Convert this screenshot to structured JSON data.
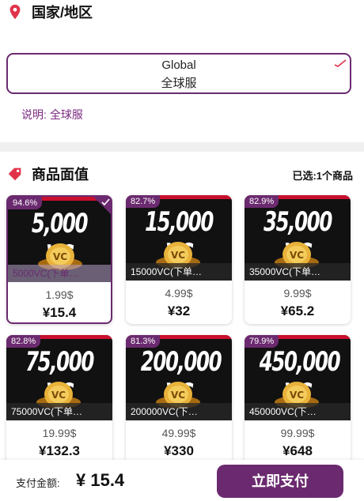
{
  "region": {
    "title": "国家/地区",
    "option_line1": "Global",
    "option_line2": "全球服",
    "note_label": "说明:",
    "note_value": "全球服"
  },
  "products": {
    "title": "商品面值",
    "selected_text": "已选:1个商品",
    "items": [
      {
        "pct": "94.6%",
        "art": "5,000 VC",
        "name": "5000VC(下单…",
        "usd": "1.99$",
        "cny": "¥15.4",
        "selected": true
      },
      {
        "pct": "82.7%",
        "art": "15,000 VC",
        "name": "15000VC(下单…",
        "usd": "4.99$",
        "cny": "¥32",
        "selected": false
      },
      {
        "pct": "82.9%",
        "art": "35,000 VC",
        "name": "35000VC(下单…",
        "usd": "9.99$",
        "cny": "¥65.2",
        "selected": false
      },
      {
        "pct": "82.8%",
        "art": "75,000 VC",
        "name": "75000VC(下单…",
        "usd": "19.99$",
        "cny": "¥132.3",
        "selected": false
      },
      {
        "pct": "81.3%",
        "art": "200,000 VC",
        "name": "200000VC(下…",
        "usd": "49.99$",
        "cny": "¥330",
        "selected": false
      },
      {
        "pct": "79.9%",
        "art": "450,000 VC",
        "name": "450000VC(下…",
        "usd": "99.99$",
        "cny": "¥648",
        "selected": false
      }
    ]
  },
  "footer": {
    "pay_label": "支付金额:",
    "total": "¥ 15.4",
    "pay_button": "立即支付"
  },
  "colors": {
    "accent": "#6b2a6f",
    "pin": "#e0334a",
    "thumb_bg": "#111111",
    "thumb_strip": "#c8102e"
  },
  "icons": {
    "region": "location-pin-icon",
    "products": "price-tag-icon",
    "check": "check-icon"
  }
}
